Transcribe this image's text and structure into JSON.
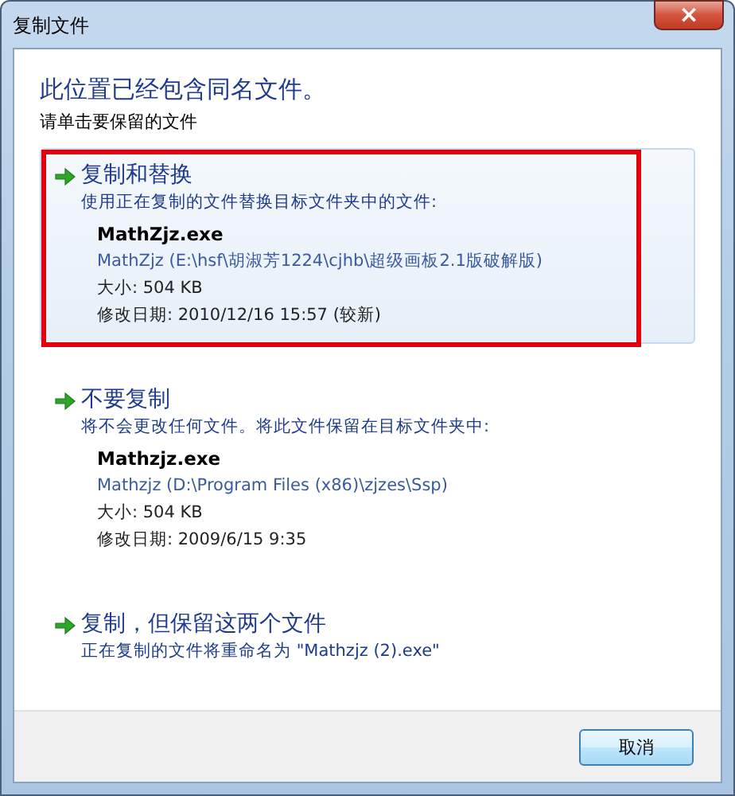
{
  "window": {
    "title": "复制文件",
    "close": "×"
  },
  "heading": "此位置已经包含同名文件。",
  "instruction": "请单击要保留的文件",
  "options": [
    {
      "title": "复制和替换",
      "description": "使用正在复制的文件替换目标文件夹中的文件:",
      "selected": true,
      "marked": true,
      "file": {
        "name": "MathZjz.exe",
        "path": "MathZjz (E:\\hsf\\胡淑芳1224\\cjhb\\超级画板2.1版破解版)",
        "size": "大小: 504 KB",
        "modified": "修改日期: 2010/12/16 15:57 (较新)"
      }
    },
    {
      "title": "不要复制",
      "description": "将不会更改任何文件。将此文件保留在目标文件夹中:",
      "selected": false,
      "marked": false,
      "file": {
        "name": "Mathzjz.exe",
        "path": "Mathzjz (D:\\Program Files (x86)\\zjzes\\Ssp)",
        "size": "大小: 504 KB",
        "modified": "修改日期: 2009/6/15 9:35"
      }
    },
    {
      "title": "复制，但保留这两个文件",
      "description": "正在复制的文件将重命名为 \"Mathzjz (2).exe\"",
      "selected": false,
      "marked": false
    }
  ],
  "buttons": [
    "取消"
  ]
}
